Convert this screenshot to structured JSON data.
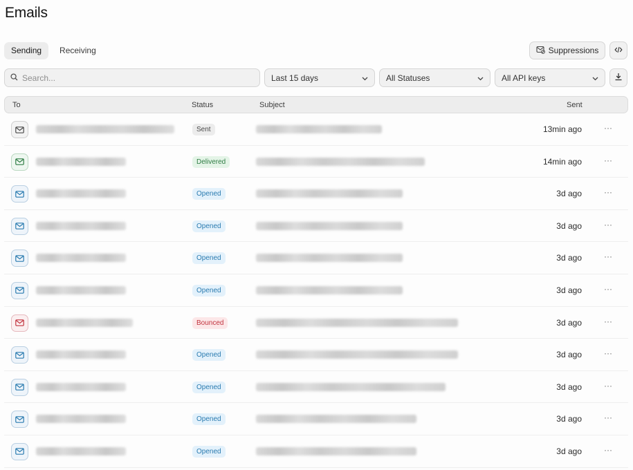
{
  "page": {
    "title": "Emails"
  },
  "tabs": [
    {
      "label": "Sending",
      "active": true
    },
    {
      "label": "Receiving",
      "active": false
    }
  ],
  "toolbar": {
    "suppressions_label": "Suppressions",
    "code_icon": "code-icon",
    "download_icon": "download-icon"
  },
  "filters": {
    "search_placeholder": "Search...",
    "search_value": "",
    "date_range": "Last 15 days",
    "status": "All Statuses",
    "api_keys": "All API keys"
  },
  "table": {
    "columns": {
      "to": "To",
      "status": "Status",
      "subject": "Subject",
      "sent": "Sent"
    },
    "rows": [
      {
        "status": "Sent",
        "status_key": "sent",
        "sent": "13min ago"
      },
      {
        "status": "Delivered",
        "status_key": "delivered",
        "sent": "14min ago"
      },
      {
        "status": "Opened",
        "status_key": "opened",
        "sent": "3d ago"
      },
      {
        "status": "Opened",
        "status_key": "opened",
        "sent": "3d ago"
      },
      {
        "status": "Opened",
        "status_key": "opened",
        "sent": "3d ago"
      },
      {
        "status": "Opened",
        "status_key": "opened",
        "sent": "3d ago"
      },
      {
        "status": "Bounced",
        "status_key": "bounced",
        "sent": "3d ago"
      },
      {
        "status": "Opened",
        "status_key": "opened",
        "sent": "3d ago"
      },
      {
        "status": "Opened",
        "status_key": "opened",
        "sent": "3d ago"
      },
      {
        "status": "Opened",
        "status_key": "opened",
        "sent": "3d ago"
      },
      {
        "status": "Opened",
        "status_key": "opened",
        "sent": "3d ago"
      }
    ]
  },
  "colors": {
    "sent": "#4a4a4a",
    "delivered": "#2f7d44",
    "opened": "#2a7bb0",
    "bounced": "#c2343f"
  }
}
